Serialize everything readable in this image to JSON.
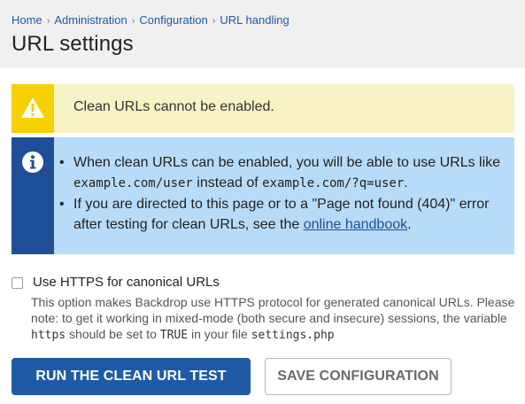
{
  "breadcrumb": {
    "items": [
      "Home",
      "Administration",
      "Configuration",
      "URL handling"
    ],
    "separator": "›"
  },
  "page": {
    "title": "URL settings"
  },
  "warning": {
    "text": "Clean URLs cannot be enabled.",
    "icon": "warning-triangle-icon",
    "color": "#f5d100",
    "background": "#f8f3c4"
  },
  "info": {
    "icon": "info-circle-icon",
    "color": "#1f4f97",
    "background": "#b7dcf9",
    "bullet1": {
      "text_a": "When clean URLs can be enabled, you will be able to use URLs like ",
      "code_a": "example.com/user",
      "text_b": " instead of ",
      "code_b": "example.com/?q=user",
      "text_c": "."
    },
    "bullet2": {
      "text_a": "If you are directed to this page or to a \"Page not found (404)\" error after testing for clean URLs, see the ",
      "link": "online handbook",
      "text_b": "."
    }
  },
  "https": {
    "label": "Use HTTPS for canonical URLs",
    "checked": false,
    "description": {
      "text_a": "This option makes Backdrop use HTTPS protocol for generated canonical URLs. Please note: to get it working in mixed-mode (both secure and insecure) sessions, the variable ",
      "code_a": "https",
      "text_b": " should be set to ",
      "code_b": "TRUE",
      "text_c": " in your file ",
      "code_c": "settings.php"
    }
  },
  "buttons": {
    "run_test": "RUN THE CLEAN URL TEST",
    "save": "SAVE CONFIGURATION",
    "primary_color": "#1f5aa6"
  }
}
